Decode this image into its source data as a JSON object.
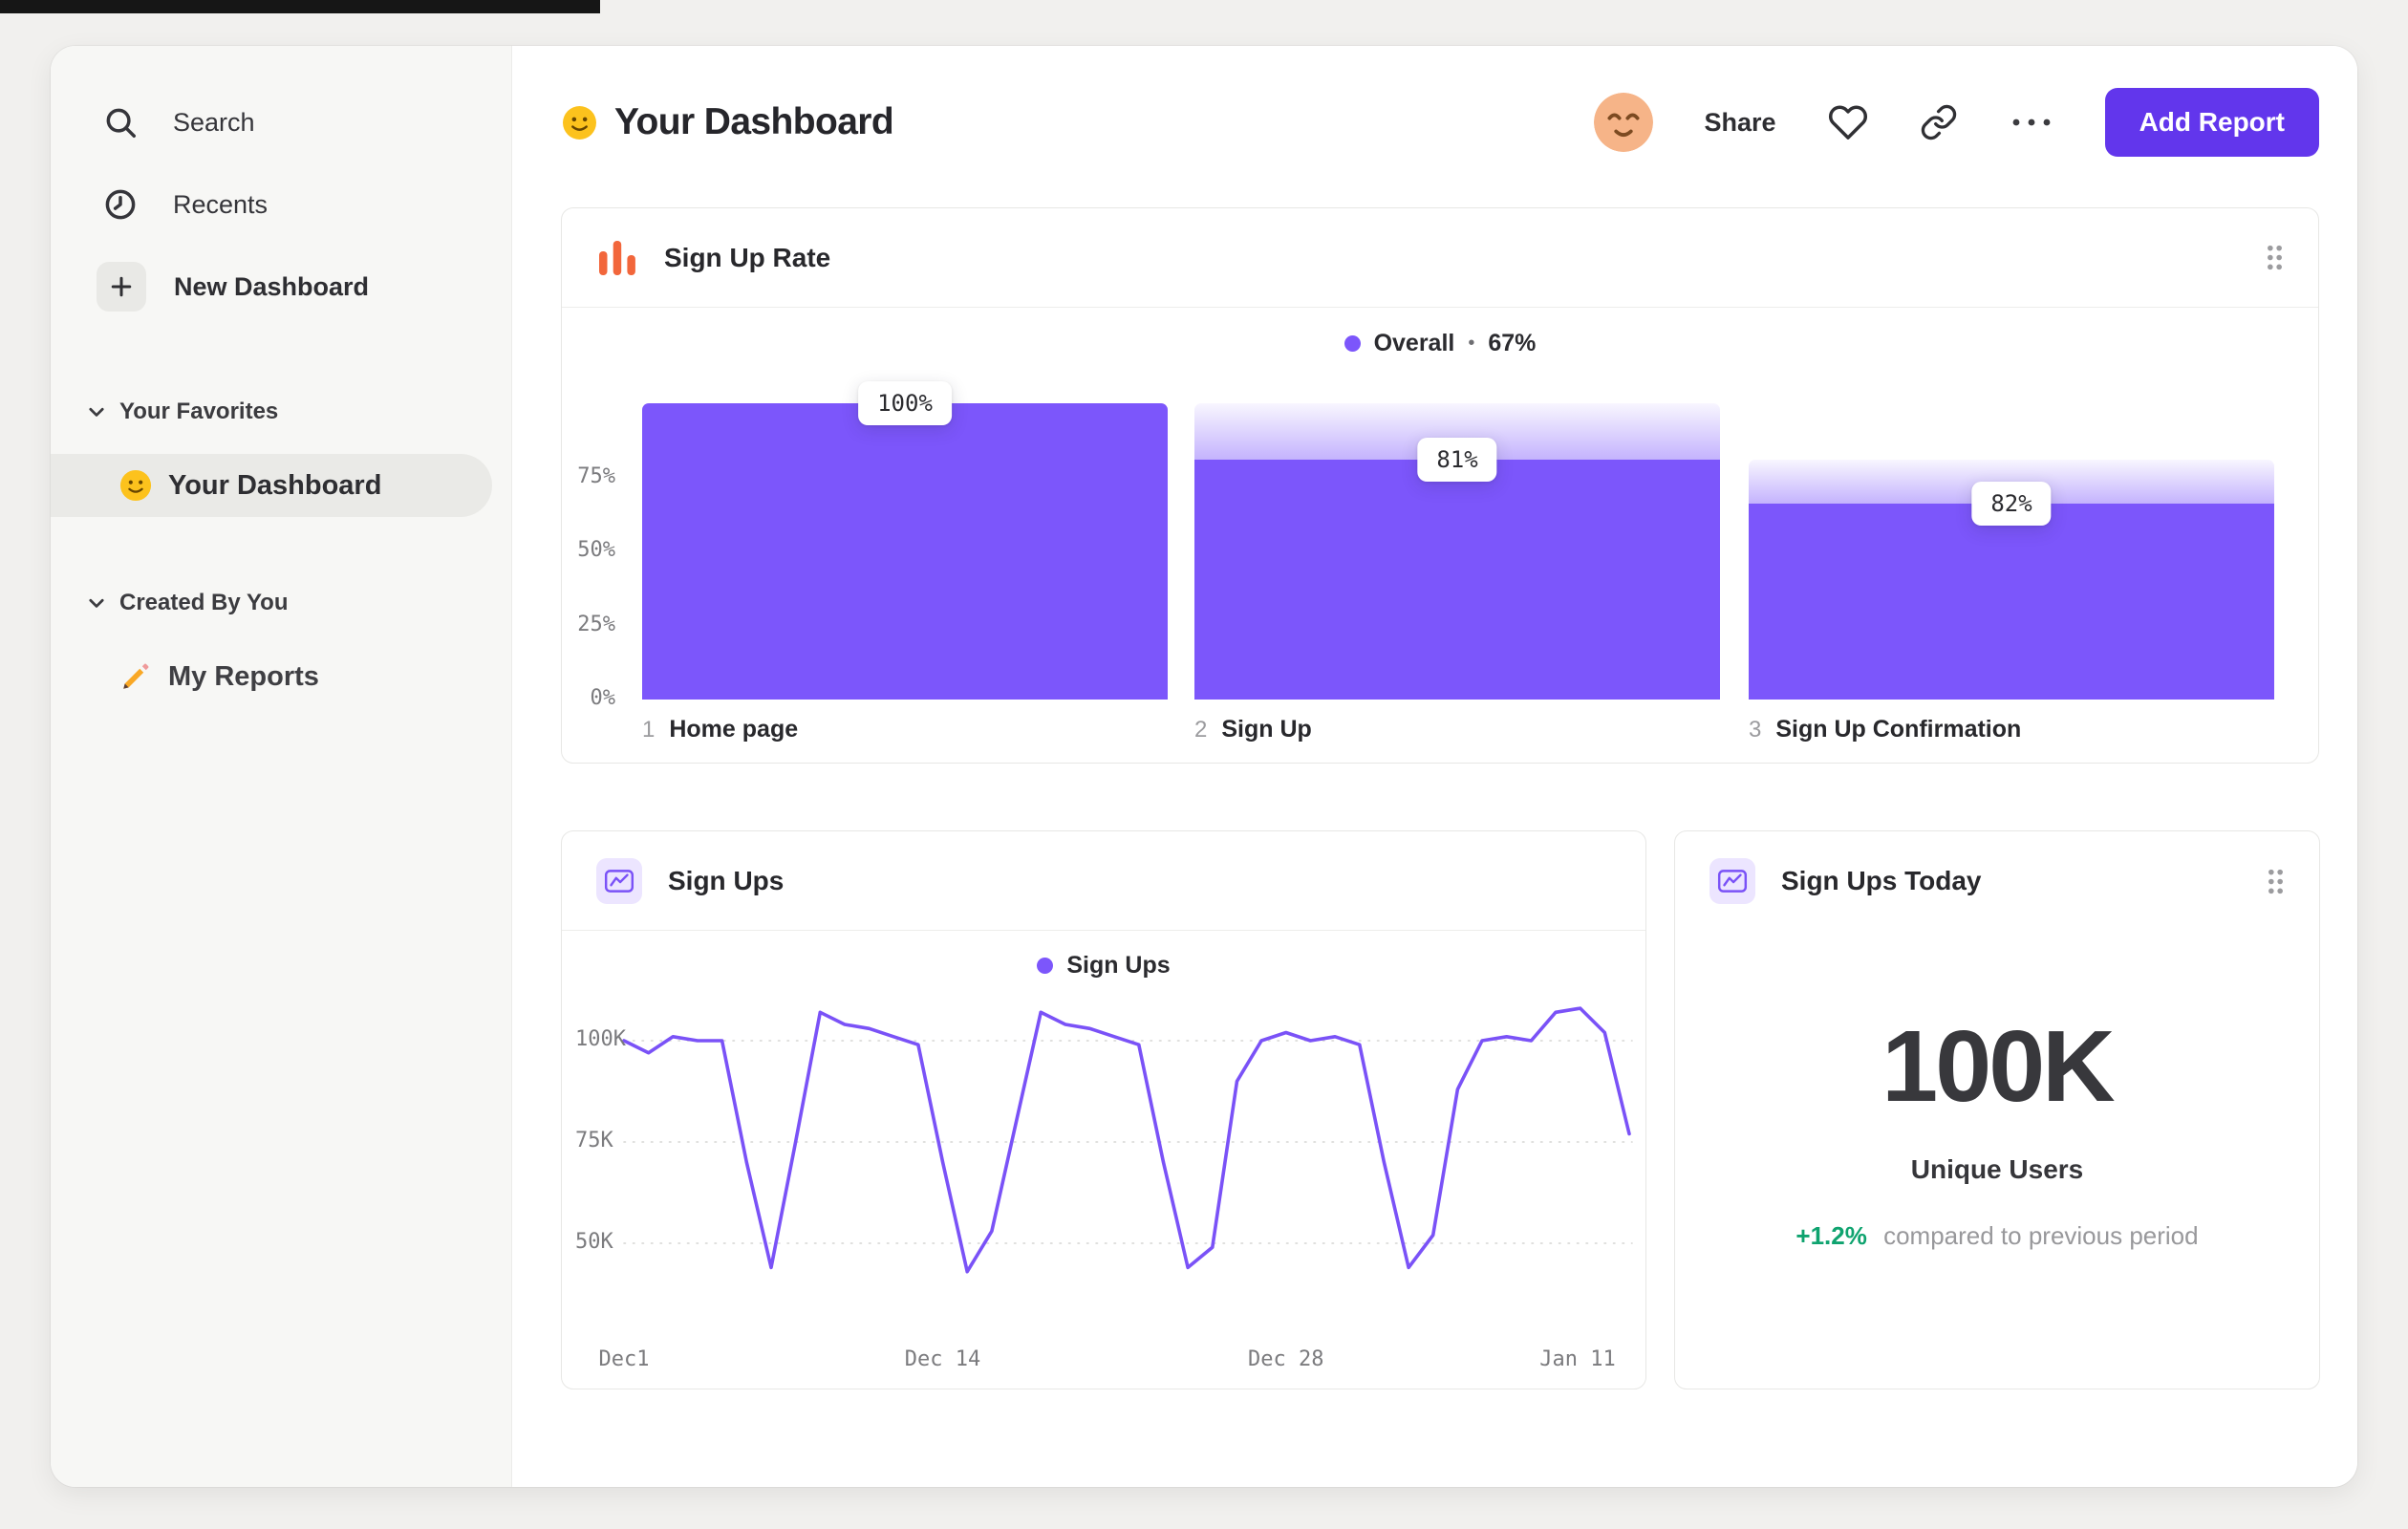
{
  "sidebar": {
    "items": [
      {
        "label": "Search",
        "icon": "search-icon"
      },
      {
        "label": "Recents",
        "icon": "clock-icon"
      },
      {
        "label": "New Dashboard",
        "icon": "plus-icon"
      }
    ],
    "sections": [
      {
        "title": "Your Favorites",
        "items": [
          {
            "label": "Your Dashboard",
            "icon": "smiley-emoji",
            "selected": true
          }
        ]
      },
      {
        "title": "Created By You",
        "items": [
          {
            "label": "My Reports",
            "icon": "pencil-emoji",
            "selected": false
          }
        ]
      }
    ]
  },
  "header": {
    "emoji": "slightly-smiling-face",
    "title": "Your Dashboard",
    "share_label": "Share",
    "add_report_label": "Add Report"
  },
  "colors": {
    "accent_purple": "#7c56fb",
    "button_purple": "#6236ec",
    "orange": "#f2663b",
    "green": "#0fa36f"
  },
  "chart_data": [
    {
      "type": "bar",
      "variant": "funnel",
      "title": "Sign Up Rate",
      "legend": {
        "series": "Overall",
        "separator": "•",
        "value": "67%"
      },
      "ylabel_ticks": [
        "75%",
        "50%",
        "25%",
        "0%"
      ],
      "ylim": [
        0,
        100
      ],
      "bars": [
        {
          "step": "1",
          "category": "Home page",
          "cumulative_pct": 100,
          "previous_pct": 100,
          "label": "100%"
        },
        {
          "step": "2",
          "category": "Sign Up",
          "cumulative_pct": 81,
          "previous_pct": 100,
          "label": "81%"
        },
        {
          "step": "3",
          "category": "Sign Up Confirmation",
          "cumulative_pct": 66,
          "previous_pct": 81,
          "label": "82%"
        }
      ]
    },
    {
      "type": "line",
      "title": "Sign Ups",
      "legend": {
        "series": "Sign Ups"
      },
      "unit": "K",
      "yticks": [
        {
          "label": "100K",
          "value": 100
        },
        {
          "label": "75K",
          "value": 75
        },
        {
          "label": "50K",
          "value": 50
        }
      ],
      "xticks": [
        {
          "label": "Dec1",
          "day": 0
        },
        {
          "label": "Dec 14",
          "day": 13
        },
        {
          "label": "Dec 28",
          "day": 27
        },
        {
          "label": "Jan 11",
          "day": 41
        }
      ],
      "values": [
        100,
        97,
        101,
        100,
        100,
        70,
        44,
        75,
        107,
        104,
        103,
        101,
        99,
        70,
        43,
        53,
        80,
        107,
        104,
        103,
        101,
        99,
        70,
        44,
        49,
        90,
        100,
        102,
        100,
        101,
        99,
        70,
        44,
        52,
        88,
        100,
        101,
        100,
        107,
        108,
        102,
        77
      ]
    },
    {
      "type": "metric",
      "title": "Sign Ups Today",
      "value": "100K",
      "label": "Unique Users",
      "delta": "+1.2%",
      "note": "compared to previous period"
    }
  ]
}
